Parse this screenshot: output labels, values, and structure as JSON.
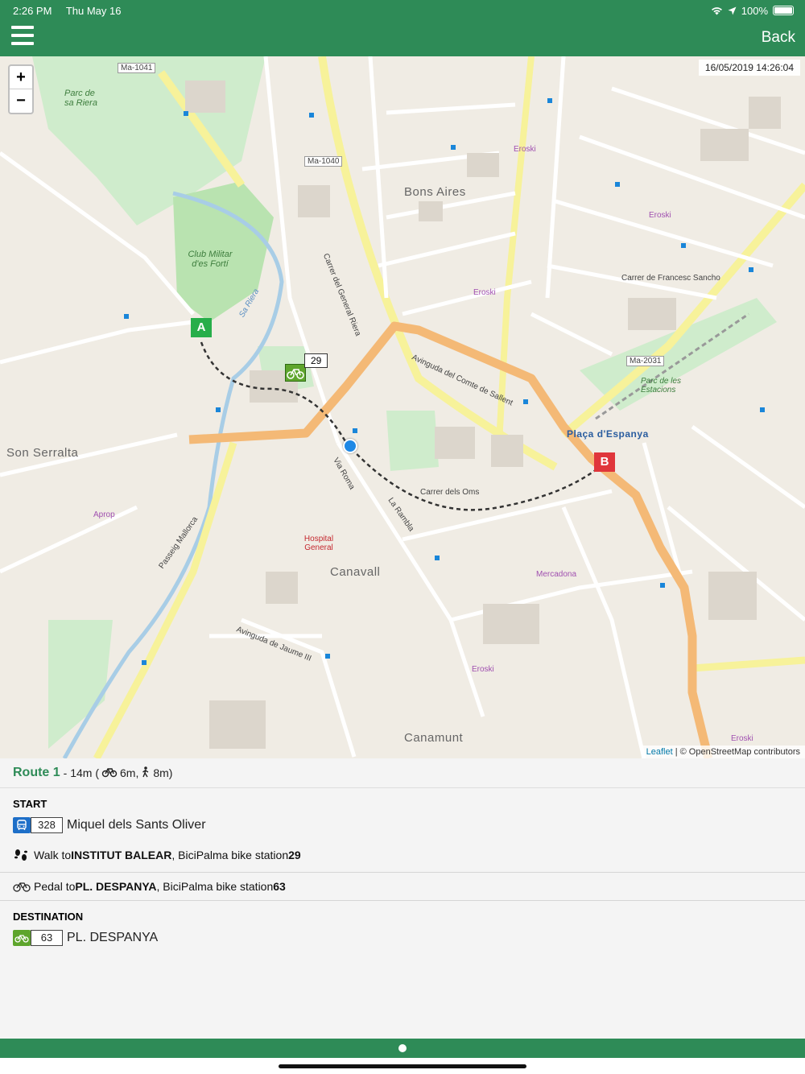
{
  "status_bar": {
    "time": "2:26 PM",
    "date": "Thu May 16",
    "battery": "100%"
  },
  "nav": {
    "back_label": "Back"
  },
  "map": {
    "timestamp": "16/05/2019 14:26:04",
    "zoom_in": "+",
    "zoom_out": "−",
    "attribution_link": "Leaflet",
    "attribution_text": " | © OpenStreetMap contributors",
    "marker_start": "A",
    "marker_end": "B",
    "bike_station_label": "29",
    "districts": {
      "bons_aires": "Bons Aires",
      "son_serralta": "Son Serralta",
      "canavall": "Canavall",
      "canamunt": "Canamunt",
      "placa_espanya": "Plaça d'Espanya"
    },
    "labels": {
      "club_militar": "Club Militar d'es Fortí",
      "parc_riera": "Parc de sa Riera",
      "hospital": "Hospital General",
      "mercadona": "Mercadona",
      "eroski": "Eroski",
      "ma_1041": "Ma-1041",
      "ma_1040": "Ma-1040",
      "ma_2031": "Ma-2031",
      "aprop": "Aprop",
      "sa_riera": "Sa Riera",
      "parc_estacions": "Parc de les Estacions",
      "avinguda_comte_sallent": "Avinguda del Comte de Sallent",
      "carrer_general_riera": "Carrer del General Riera",
      "passeig_mallorca": "Passeig Mallorca",
      "via_roma": "Via Roma",
      "la_rambla": "La Rambla",
      "carrer_oms": "Carrer dels Oms",
      "avinguda_jaume_iii": "Avinguda de Jaume III",
      "carrer_francesc_sancho": "Carrer de Francesc Sancho"
    }
  },
  "route": {
    "name": "Route 1",
    "summary_prefix": " - 14m (",
    "bike_time": "6m,",
    "walk_time": "8m)",
    "start_title": "START",
    "start_stop_number": "328",
    "start_stop_name": "Miquel dels Sants Oliver",
    "walk_prefix": "Walk to ",
    "walk_target": "INSTITUT BALEAR",
    "walk_middle": ", BiciPalma bike station ",
    "walk_station": "29",
    "pedal_prefix": "Pedal to ",
    "pedal_target": "PL. DESPANYA",
    "pedal_middle": ", BiciPalma bike station ",
    "pedal_station": "63",
    "destination_title": "DESTINATION",
    "dest_stop_number": "63",
    "dest_stop_name": "PL. DESPANYA"
  },
  "colors": {
    "brand_green": "#2e8b57",
    "route_orange": "#f4b976",
    "bus_blue": "#1e6fc8",
    "bike_green": "#5ea52c"
  }
}
